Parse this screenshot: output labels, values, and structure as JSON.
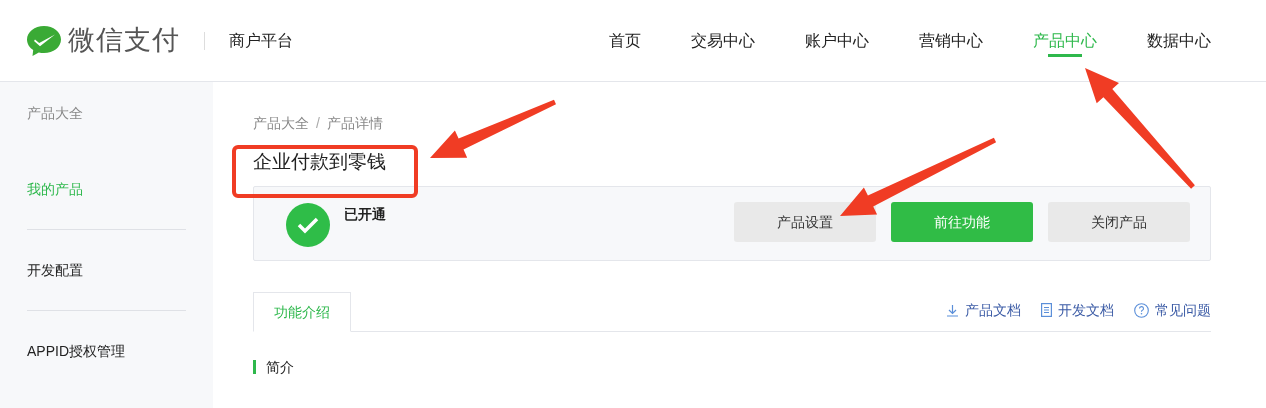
{
  "header": {
    "brand": "微信支付",
    "platform": "商户平台",
    "nav": [
      {
        "label": "首页",
        "selected": false
      },
      {
        "label": "交易中心",
        "selected": false
      },
      {
        "label": "账户中心",
        "selected": false
      },
      {
        "label": "营销中心",
        "selected": false
      },
      {
        "label": "产品中心",
        "selected": true
      },
      {
        "label": "数据中心",
        "selected": false
      }
    ]
  },
  "sidebar": {
    "items": [
      {
        "label": "产品大全",
        "kind": "muted",
        "selected": false
      },
      {
        "label": "我的产品",
        "kind": "link",
        "selected": true
      },
      {
        "label": "开发配置",
        "kind": "link",
        "selected": false
      },
      {
        "label": "APPID授权管理",
        "kind": "link",
        "selected": false
      }
    ]
  },
  "breadcrumb": {
    "items": [
      "产品大全",
      "产品详情"
    ],
    "separator": "/"
  },
  "title": "企业付款到零钱",
  "status": {
    "label": "已开通",
    "enabled": true
  },
  "buttons": [
    {
      "label": "产品设置",
      "primary": false
    },
    {
      "label": "前往功能",
      "primary": true
    },
    {
      "label": "关闭产品",
      "primary": false
    }
  ],
  "tabs": [
    {
      "label": "功能介绍",
      "selected": true
    }
  ],
  "doc_links": [
    {
      "label": "产品文档",
      "kind": "download"
    },
    {
      "label": "开发文档",
      "kind": "document"
    },
    {
      "label": "常见问题",
      "kind": "help"
    }
  ],
  "section_title": "简介"
}
